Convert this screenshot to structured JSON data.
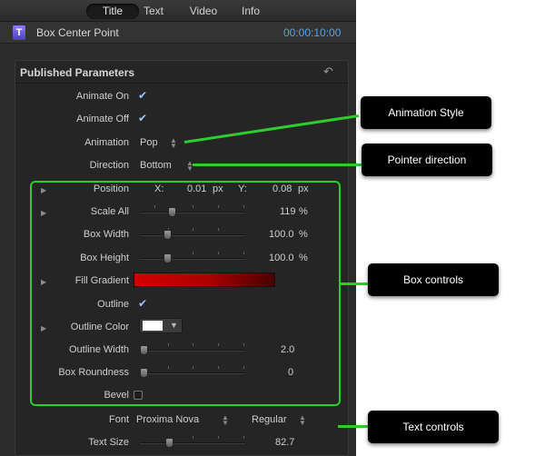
{
  "tabs": [
    "Title",
    "Text",
    "Video",
    "Info"
  ],
  "header": {
    "title": "Box Center Point",
    "timecode": "00:00:10:00",
    "icon_letter": "T"
  },
  "section": {
    "title": "Published Parameters",
    "reset_icon": "reset-icon"
  },
  "params": {
    "animate_on": "Animate On",
    "animate_off": "Animate Off",
    "animation": "Animation",
    "animation_value": "Pop",
    "direction": "Direction",
    "direction_value": "Bottom",
    "position": "Position",
    "pos_x_label": "X:",
    "pos_x_value": "0.01",
    "pos_x_unit": "px",
    "pos_y_label": "Y:",
    "pos_y_value": "0.08",
    "pos_y_unit": "px",
    "scale_all": "Scale All",
    "scale_all_value": "119",
    "scale_all_unit": "%",
    "box_width": "Box Width",
    "box_width_value": "100.0",
    "box_width_unit": "%",
    "box_height": "Box Height",
    "box_height_value": "100.0",
    "box_height_unit": "%",
    "fill_gradient": "Fill Gradient",
    "outline": "Outline",
    "outline_color": "Outline Color",
    "outline_width": "Outline Width",
    "outline_width_value": "2.0",
    "box_roundness": "Box Roundness",
    "box_roundness_value": "0",
    "bevel": "Bevel",
    "font": "Font",
    "font_value": "Proxima Nova",
    "font_style": "Regular",
    "text_size": "Text Size",
    "text_size_value": "82.7"
  },
  "callouts": {
    "animation_style": "Animation Style",
    "pointer_direction": "Pointer direction",
    "box_controls": "Box controls",
    "text_controls": "Text controls"
  },
  "colors": {
    "accent_time": "#5aa0e6",
    "annotation_green": "#2ecc2e",
    "fill_gradient_start": "#d40000",
    "outline_color": "#ffffff"
  }
}
